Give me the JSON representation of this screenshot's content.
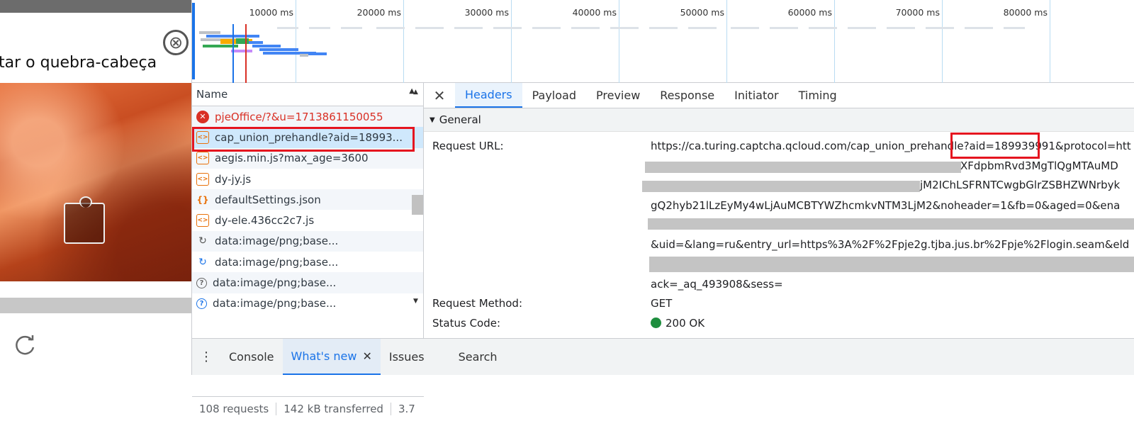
{
  "captcha": {
    "title": "tar o quebra-cabeça",
    "close_glyph": "⊗"
  },
  "overview": {
    "ticks": [
      "10000 ms",
      "20000 ms",
      "30000 ms",
      "40000 ms",
      "50000 ms",
      "60000 ms",
      "70000 ms",
      "80000 ms"
    ]
  },
  "requests": {
    "column": "Name",
    "items": [
      {
        "label": "pjeOffice/?&u=1713861150055",
        "icon": "error-icon"
      },
      {
        "label": "cap_union_prehandle?aid=18993...",
        "icon": "script-icon"
      },
      {
        "label": "aegis.min.js?max_age=3600",
        "icon": "script-icon"
      },
      {
        "label": "dy-jy.js",
        "icon": "script-icon"
      },
      {
        "label": "defaultSettings.json",
        "icon": "json-icon"
      },
      {
        "label": "dy-ele.436cc2c7.js",
        "icon": "script-icon"
      },
      {
        "label": "data:image/png;base...",
        "icon": "pending-icon"
      },
      {
        "label": "data:image/png;base...",
        "icon": "pending-icon"
      },
      {
        "label": "data:image/png;base...",
        "icon": "unknown-icon"
      },
      {
        "label": "data:image/png;base...",
        "icon": "unknown-icon"
      }
    ],
    "status": {
      "requests": "108 requests",
      "transferred": "142 kB transferred",
      "resources": "3.7"
    }
  },
  "detail": {
    "tabs": [
      "Headers",
      "Payload",
      "Preview",
      "Response",
      "Initiator",
      "Timing"
    ],
    "active_tab": "Headers",
    "section": "General",
    "request_url_label": "Request URL:",
    "url_lines": [
      "https://ca.turing.captcha.qcloud.com/cap_union_prehandle?aid=189939991&protocol=htt",
      "XFdpbmRvd3MgTlQgMTAuMD",
      "jM2IChLSFRNTCwgbGlrZSBHZWNrbyk",
      "gQ2hyb21lLzEyMy4wLjAuMCBTYWZhcmkvNTM3LjM2&noheader=1&fb=0&aged=0&ena",
      "&uid=&lang=ru&entry_url=https%3A%2F%2Fpje2g.tjba.jus.br%2Fpje%2Flogin.seam&eld",
      "ack=_aq_493908&sess="
    ],
    "method_label": "Request Method:",
    "method": "GET",
    "status_label": "Status Code:",
    "status": "200 OK"
  },
  "drawer": {
    "tabs": [
      "Console",
      "What's new",
      "Issues",
      "Search"
    ],
    "active_tab": "What's new"
  },
  "colors": {
    "accent": "#1a73e8",
    "error": "#d93025",
    "highlight": "#e5151f",
    "ok": "#1e8e3e"
  }
}
